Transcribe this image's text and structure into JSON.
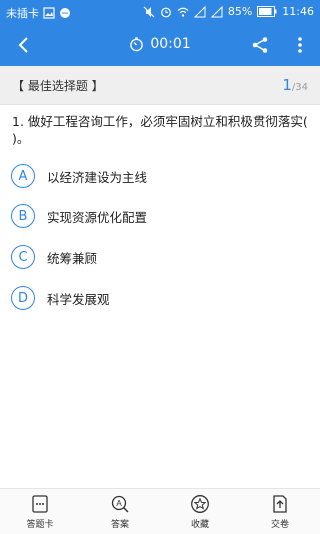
{
  "status_bar": {
    "carrier": "未插卡",
    "battery": "85%",
    "time": "11:46"
  },
  "header": {
    "timer": "00:01"
  },
  "question_type": {
    "label": "【 最佳选择题 】",
    "current": "1",
    "total": "/34"
  },
  "question": {
    "text": "1. 做好工程咨询工作，必须牢固树立和积极贯彻落实(    )。"
  },
  "options": [
    {
      "letter": "A",
      "text": "以经济建设为主线"
    },
    {
      "letter": "B",
      "text": "实现资源优化配置"
    },
    {
      "letter": "C",
      "text": "统筹兼顾"
    },
    {
      "letter": "D",
      "text": "科学发展观"
    }
  ],
  "bottom_tabs": [
    {
      "label": "答题卡",
      "icon": "answer-sheet-icon"
    },
    {
      "label": "答案",
      "icon": "answer-search-icon"
    },
    {
      "label": "收藏",
      "icon": "star-icon"
    },
    {
      "label": "交卷",
      "icon": "submit-icon"
    }
  ],
  "colors": {
    "accent": "#2f86e3",
    "type_bar_bg": "#efefef"
  }
}
